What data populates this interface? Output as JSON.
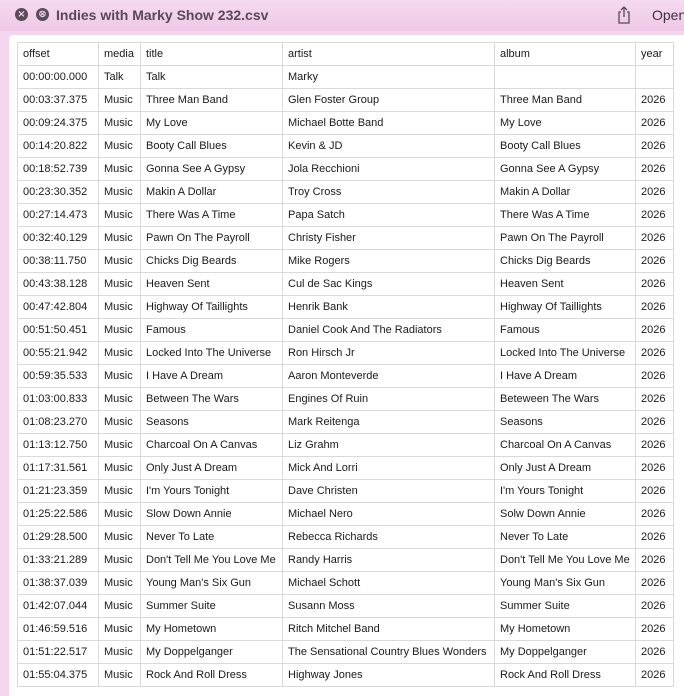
{
  "window": {
    "title": "Indies with Marky Show 232.csv",
    "open_label": "Open",
    "close_symbol": "×",
    "fullscreen_symbol": "⊗"
  },
  "table": {
    "headers": [
      "offset",
      "media",
      "title",
      "artist",
      "album",
      "year"
    ],
    "rows": [
      [
        "00:00:00.000",
        "Talk",
        "Talk",
        "Marky",
        "",
        ""
      ],
      [
        "00:03:37.375",
        "Music",
        "Three Man Band",
        "Glen Foster Group",
        "Three Man Band",
        "2026"
      ],
      [
        "00:09:24.375",
        "Music",
        "My Love",
        "Michael Botte Band",
        "My Love",
        "2026"
      ],
      [
        "00:14:20.822",
        "Music",
        "Booty Call Blues",
        "Kevin & JD",
        "Booty Call Blues",
        "2026"
      ],
      [
        "00:18:52.739",
        "Music",
        "Gonna See A Gypsy",
        "Jola Recchioni",
        "Gonna See A Gypsy",
        "2026"
      ],
      [
        "00:23:30.352",
        "Music",
        "Makin A Dollar",
        "Troy Cross",
        "Makin A Dollar",
        "2026"
      ],
      [
        "00:27:14.473",
        "Music",
        "There Was A Time",
        "Papa Satch",
        "There Was A Time",
        "2026"
      ],
      [
        "00:32:40.129",
        "Music",
        "Pawn On The Payroll",
        "Christy Fisher",
        "Pawn On The Payroll",
        "2026"
      ],
      [
        "00:38:11.750",
        "Music",
        "Chicks Dig Beards",
        "Mike Rogers",
        "Chicks Dig Beards",
        "2026"
      ],
      [
        "00:43:38.128",
        "Music",
        "Heaven Sent",
        "Cul de Sac Kings",
        "Heaven Sent",
        "2026"
      ],
      [
        "00:47:42.804",
        "Music",
        "Highway Of Taillights",
        "Henrik Bank",
        "Highway Of Taillights",
        "2026"
      ],
      [
        "00:51:50.451",
        "Music",
        "Famous",
        "Daniel Cook And The Radiators",
        "Famous",
        "2026"
      ],
      [
        "00:55:21.942",
        "Music",
        "Locked Into The Universe",
        "Ron Hirsch Jr",
        "Locked Into The Universe",
        "2026"
      ],
      [
        "00:59:35.533",
        "Music",
        "I Have A Dream",
        "Aaron Monteverde",
        "I Have A Dream",
        "2026"
      ],
      [
        "01:03:00.833",
        "Music",
        "Between The Wars",
        "Engines Of Ruin",
        "Beteween The Wars",
        "2026"
      ],
      [
        "01:08:23.270",
        "Music",
        "Seasons",
        "Mark Reitenga",
        "Seasons",
        "2026"
      ],
      [
        "01:13:12.750",
        "Music",
        "Charcoal On A Canvas",
        "Liz Grahm",
        "Charcoal On A Canvas",
        "2026"
      ],
      [
        "01:17:31.561",
        "Music",
        "Only Just A Dream",
        "Mick And Lorri",
        "Only Just A Dream",
        "2026"
      ],
      [
        "01:21:23.359",
        "Music",
        "I'm Yours Tonight",
        "Dave Christen",
        "I'm Yours Tonight",
        "2026"
      ],
      [
        "01:25:22.586",
        "Music",
        "Slow Down Annie",
        "Michael Nero",
        "Solw Down Annie",
        "2026"
      ],
      [
        "01:29:28.500",
        "Music",
        "Never To Late",
        "Rebecca Richards",
        "Never To Late",
        "2026"
      ],
      [
        "01:33:21.289",
        "Music",
        "Don't Tell Me You Love Me",
        "Randy Harris",
        "Don't Tell Me You Love Me",
        "2026"
      ],
      [
        "01:38:37.039",
        "Music",
        "Young Man's Six Gun",
        "Michael Schott",
        "Young Man's Six Gun",
        "2026"
      ],
      [
        "01:42:07.044",
        "Music",
        "Summer Suite",
        "Susann Moss",
        "Summer Suite",
        "2026"
      ],
      [
        "01:46:59.516",
        "Music",
        "My Hometown",
        "Ritch Mitchel Band",
        "My Hometown",
        "2026"
      ],
      [
        "01:51:22.517",
        "Music",
        "My Doppelganger",
        "The Sensational Country Blues Wonders",
        "My Doppelganger",
        "2026"
      ],
      [
        "01:55:04.375",
        "Music",
        "Rock And Roll Dress",
        "Highway Jones",
        "Rock And Roll Dress",
        "2026"
      ]
    ]
  }
}
